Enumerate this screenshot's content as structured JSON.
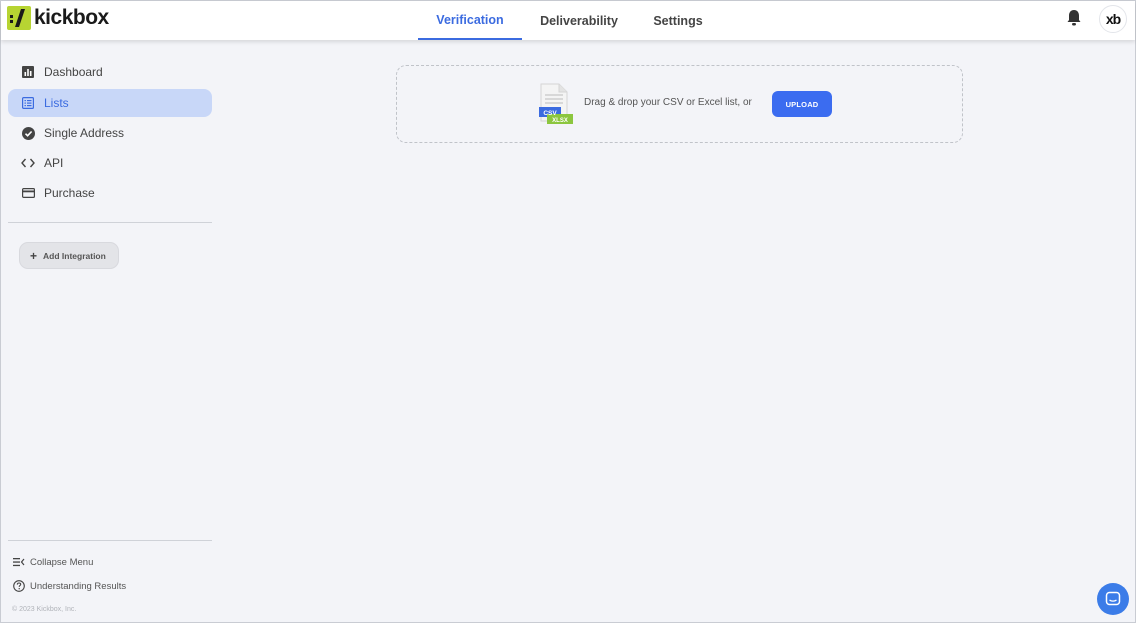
{
  "header": {
    "logo_text": "kickbox",
    "tabs": [
      {
        "label": "Verification",
        "active": true
      },
      {
        "label": "Deliverability",
        "active": false
      },
      {
        "label": "Settings",
        "active": false
      }
    ],
    "avatar_text": "xb"
  },
  "sidebar": {
    "items": [
      {
        "label": "Dashboard",
        "icon": "chart-icon"
      },
      {
        "label": "Lists",
        "icon": "list-icon",
        "active": true
      },
      {
        "label": "Single Address",
        "icon": "check-circle-icon"
      },
      {
        "label": "API",
        "icon": "code-icon"
      },
      {
        "label": "Purchase",
        "icon": "credit-card-icon"
      }
    ],
    "add_integration_label": "Add Integration",
    "collapse_label": "Collapse Menu",
    "understanding_label": "Understanding Results",
    "copyright": "© 2023 Kickbox, Inc."
  },
  "dropzone": {
    "text": "Drag & drop your CSV or Excel list, or",
    "upload_label": "UPLOAD",
    "csv_label": "CSV",
    "xlsx_label": "XLSX"
  },
  "colors": {
    "accent": "#3b6be0",
    "brand_green": "#b7d432",
    "active_bg": "#c8d7f8"
  }
}
